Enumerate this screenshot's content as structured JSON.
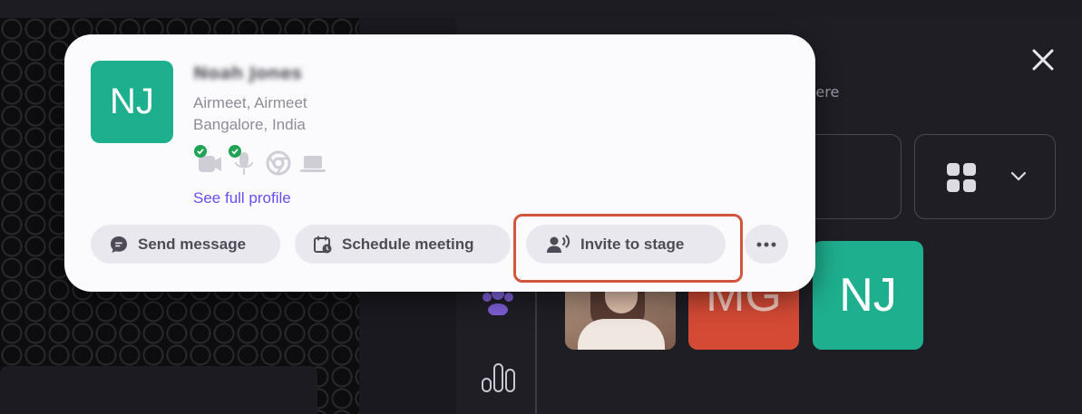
{
  "profile": {
    "initials": "NJ",
    "name": "Noah Jones",
    "organization": "Airmeet, Airmeet",
    "location": "Bangalore, India",
    "see_full_profile": "See full profile",
    "devices": [
      {
        "icon": "camera-icon",
        "status": "ok"
      },
      {
        "icon": "microphone-icon",
        "status": "ok"
      },
      {
        "icon": "chrome-browser-icon",
        "status": "none"
      },
      {
        "icon": "laptop-icon",
        "status": "none"
      }
    ]
  },
  "actions": {
    "send_message": "Send message",
    "schedule_meeting": "Schedule meeting",
    "invite_to_stage": "Invite to stage",
    "more": "more-options-icon"
  },
  "background": {
    "hint_text": "n here",
    "tiles": [
      {
        "kind": "photo"
      },
      {
        "initials": "MG",
        "color": "#d44a35"
      },
      {
        "initials": "NJ",
        "color": "#1eaf8e"
      }
    ]
  },
  "colors": {
    "accent": "#6a4df0",
    "avatar": "#1eaf8e",
    "highlight": "#d2553e",
    "check": "#1fa355"
  }
}
